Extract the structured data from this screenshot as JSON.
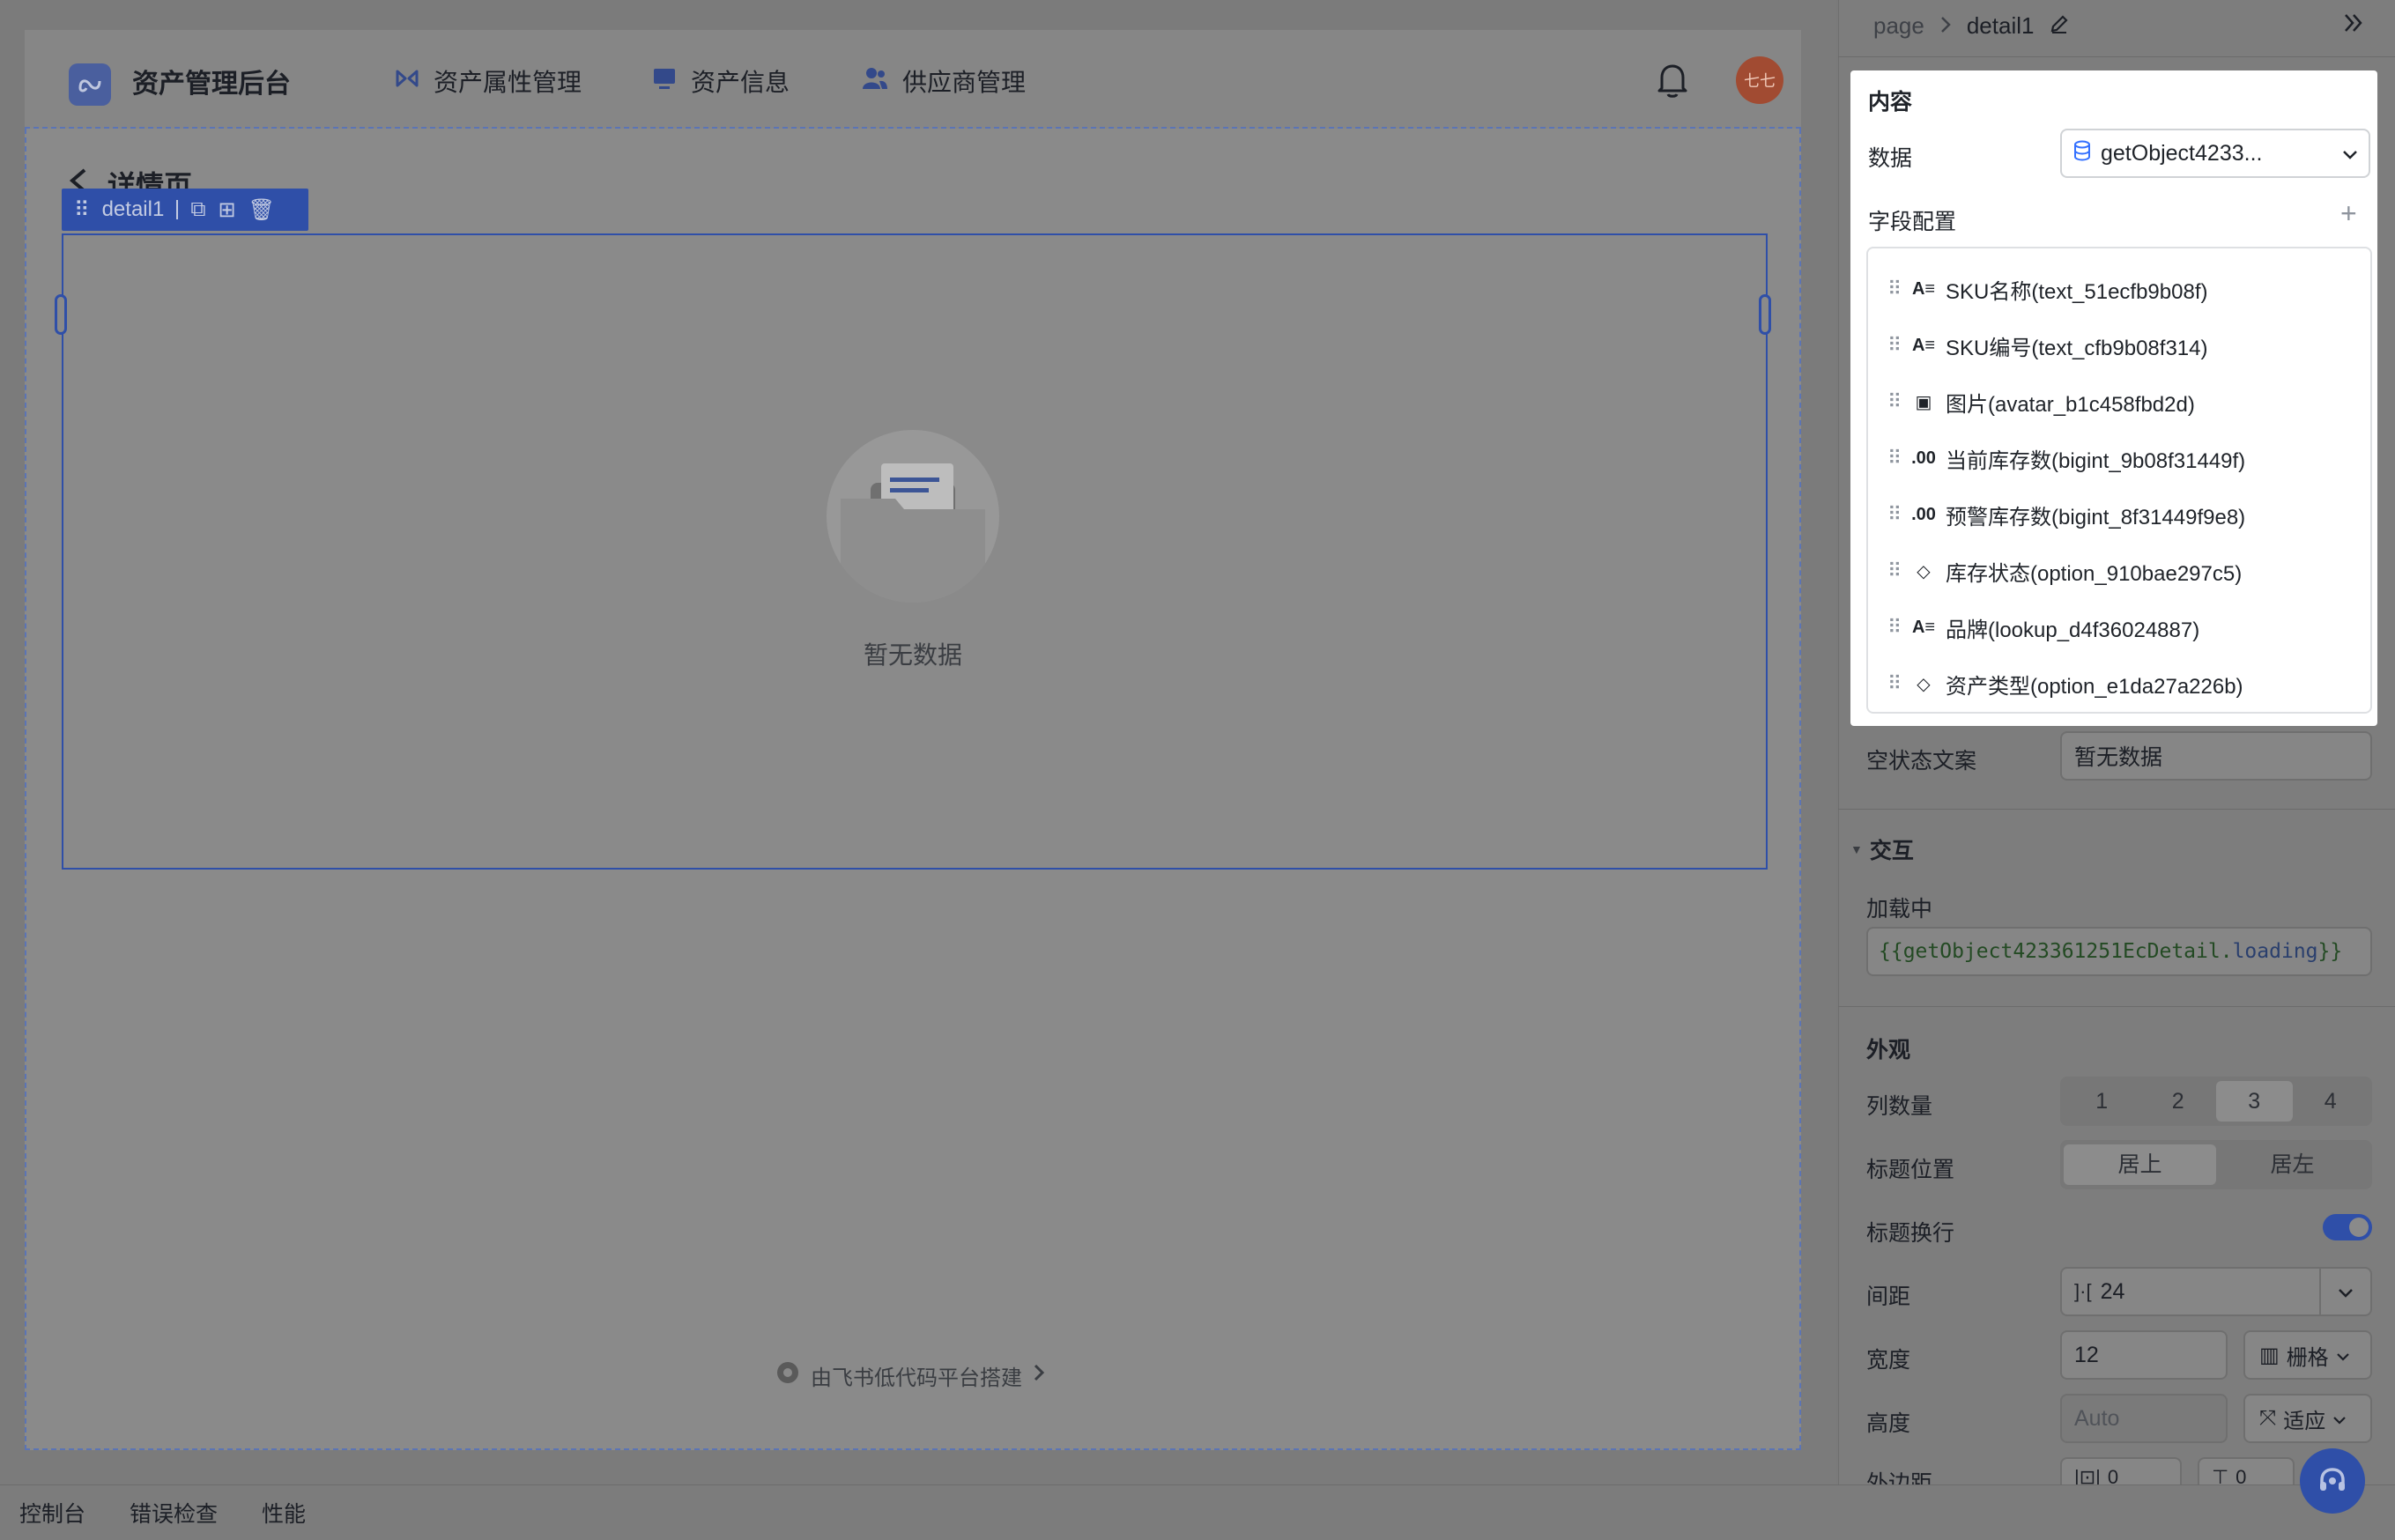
{
  "app": {
    "title": "资产管理后台",
    "nav": [
      {
        "label": "资产属性管理",
        "icon": "bowtie-icon"
      },
      {
        "label": "资产信息",
        "icon": "monitor-icon"
      },
      {
        "label": "供应商管理",
        "icon": "users-icon"
      }
    ],
    "avatar_text": "七七"
  },
  "page": {
    "title": "详情页",
    "component_label": "detail1",
    "empty_text": "暂无数据",
    "footer_credit": "由飞书低代码平台搭建"
  },
  "bottom_bar": {
    "tabs": [
      "控制台",
      "错误检查",
      "性能"
    ]
  },
  "panel": {
    "breadcrumb_root": "page",
    "breadcrumb_current": "detail1",
    "content": {
      "section_title": "内容",
      "data_label": "数据",
      "data_value": "getObject4233...",
      "fields_label": "字段配置",
      "fields": [
        {
          "icon": "text-icon",
          "glyph": "A≡",
          "label": "SKU名称(text_51ecfb9b08f)"
        },
        {
          "icon": "text-icon",
          "glyph": "A≡",
          "label": "SKU编号(text_cfb9b08f314)"
        },
        {
          "icon": "image-icon",
          "glyph": "▣",
          "label": "图片(avatar_b1c458fbd2d)"
        },
        {
          "icon": "number-icon",
          "glyph": ".00",
          "label": "当前库存数(bigint_9b08f31449f)"
        },
        {
          "icon": "number-icon",
          "glyph": ".00",
          "label": "预警库存数(bigint_8f31449f9e8)"
        },
        {
          "icon": "tag-icon",
          "glyph": "◇",
          "label": "库存状态(option_910bae297c5)"
        },
        {
          "icon": "text-icon",
          "glyph": "A≡",
          "label": "品牌(lookup_d4f36024887)"
        },
        {
          "icon": "tag-icon",
          "glyph": "◇",
          "label": "资产类型(option_e1da27a226b)"
        }
      ],
      "empty_label": "空状态文案",
      "empty_value": "暂无数据"
    },
    "interaction": {
      "section_title": "交互",
      "loading_label": "加载中",
      "loading_prefix": "{{getObject423361251EcDetail.",
      "loading_keyword": "loading",
      "loading_suffix": "}}"
    },
    "appearance": {
      "section_title": "外观",
      "columns_label": "列数量",
      "columns_options": [
        "1",
        "2",
        "3",
        "4"
      ],
      "title_pos_label": "标题位置",
      "title_pos_options": [
        "居上",
        "居左"
      ],
      "title_wrap_label": "标题换行",
      "spacing_label": "间距",
      "spacing_value": "24",
      "width_label": "宽度",
      "width_value": "12",
      "width_unit": "栅格",
      "height_label": "高度",
      "height_placeholder": "Auto",
      "height_unit": "适应",
      "margin_label": "外边距",
      "margin_value_1": "0",
      "margin_value_2": "0"
    }
  }
}
